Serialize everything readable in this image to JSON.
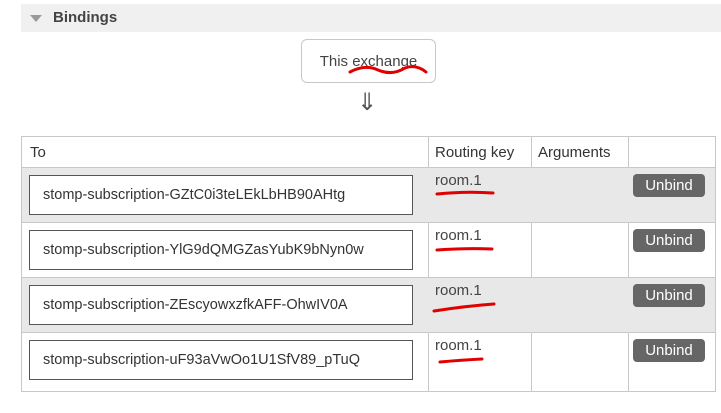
{
  "section": {
    "title": "Bindings"
  },
  "exchange": {
    "prefix": "This ",
    "name": "exchange"
  },
  "arrow": "⇓",
  "table": {
    "headers": {
      "to": "To",
      "routing_key": "Routing key",
      "arguments": "Arguments"
    },
    "rows": [
      {
        "destination": "stomp-subscription-GZtC0i3teLEkLbHB90AHtg",
        "routing_key": "room.1",
        "arguments": "",
        "action": "Unbind"
      },
      {
        "destination": "stomp-subscription-YlG9dQMGZasYubK9bNyn0w",
        "routing_key": "room.1",
        "arguments": "",
        "action": "Unbind"
      },
      {
        "destination": "stomp-subscription-ZEscyowxzfkAFF-OhwIV0A",
        "routing_key": "room.1",
        "arguments": "",
        "action": "Unbind"
      },
      {
        "destination": "stomp-subscription-uF93aVwOo1U1SfV89_pTuQ",
        "routing_key": "room.1",
        "arguments": "",
        "action": "Unbind"
      }
    ]
  },
  "annotation_color": "#e00000"
}
